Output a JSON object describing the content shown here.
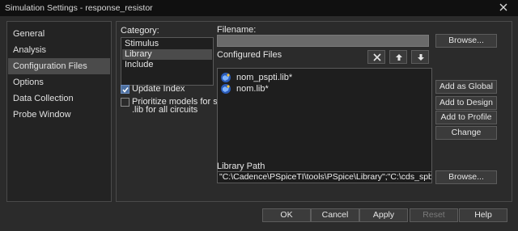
{
  "window": {
    "title": "Simulation Settings - response_resistor"
  },
  "nav": {
    "items": [
      {
        "label": "General"
      },
      {
        "label": "Analysis"
      },
      {
        "label": "Configuration Files",
        "selected": true
      },
      {
        "label": "Options"
      },
      {
        "label": "Data Collection"
      },
      {
        "label": "Probe Window"
      }
    ]
  },
  "category": {
    "label": "Category:",
    "items": [
      {
        "label": "Stimulus"
      },
      {
        "label": "Library",
        "selected": true
      },
      {
        "label": "Include"
      }
    ]
  },
  "options": {
    "update_index": {
      "label": "Update Index",
      "checked": true
    },
    "prioritize": {
      "line1": "Prioritize models for same",
      "line2": ".lib for all circuits",
      "checked": false
    }
  },
  "filename": {
    "label": "Filename:",
    "value": "",
    "browse_label": "Browse..."
  },
  "configured_files": {
    "label": "Configured Files",
    "files": [
      {
        "name": "nom_pspti.lib*"
      },
      {
        "name": "nom.lib*"
      }
    ]
  },
  "side_buttons": {
    "add_global": "Add as Global",
    "add_design": "Add to Design",
    "add_profile": "Add to Profile",
    "change": "Change"
  },
  "library_path": {
    "label": "Library Path",
    "value": "\"C:\\Cadence\\PSpiceTI\\tools\\PSpice\\Library\";\"C:\\cds_spb_home\\cdssetup",
    "browse_label": "Browse..."
  },
  "footer": {
    "ok": "OK",
    "cancel": "Cancel",
    "apply": "Apply",
    "reset": "Reset",
    "help": "Help"
  },
  "icons": {
    "delete": "close-x-icon",
    "move_up": "arrow-up-icon",
    "move_down": "arrow-down-icon",
    "file": "library-file-icon"
  },
  "colors": {
    "selection": "#4b4b4b",
    "panel": "#2b2b2b",
    "titlebar": "#101010"
  }
}
